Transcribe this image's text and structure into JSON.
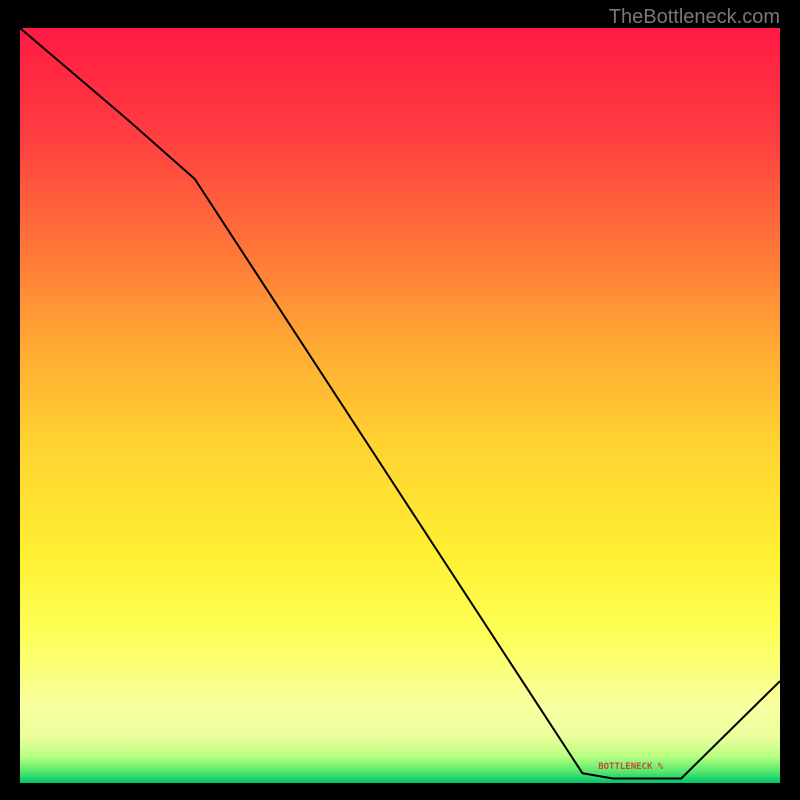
{
  "watermark": "TheBottleneck.com",
  "chart_data": {
    "type": "line",
    "title": "",
    "xlabel": "",
    "ylabel": "",
    "x": [
      0.0,
      0.14,
      0.23,
      0.74,
      0.78,
      0.87,
      1.0
    ],
    "y": [
      1.0,
      0.88,
      0.8,
      0.013,
      0.006,
      0.006,
      0.135
    ],
    "xlim": [
      0,
      1
    ],
    "ylim": [
      0,
      1
    ],
    "annotations": [
      {
        "text_key": "annotation_text",
        "x": 0.82,
        "y": 0.02
      }
    ]
  },
  "annotation_text": "BOTTLENECK %"
}
